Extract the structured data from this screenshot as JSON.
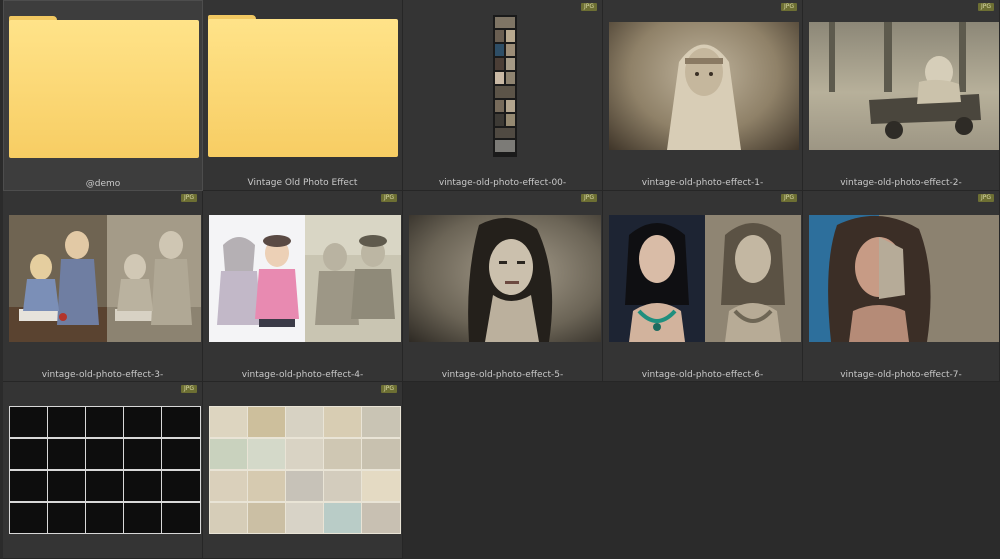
{
  "items": [
    {
      "name": "@demo",
      "type": "folder",
      "badge": ""
    },
    {
      "name": "Vintage Old Photo Effect",
      "type": "folder",
      "badge": ""
    },
    {
      "name": "vintage-old-photo-effect-00-",
      "type": "image",
      "badge": "JPG"
    },
    {
      "name": "vintage-old-photo-effect-1-",
      "type": "image",
      "badge": "JPG"
    },
    {
      "name": "vintage-old-photo-effect-2-",
      "type": "image",
      "badge": "JPG"
    },
    {
      "name": "vintage-old-photo-effect-3-",
      "type": "image",
      "badge": "JPG"
    },
    {
      "name": "vintage-old-photo-effect-4-",
      "type": "image",
      "badge": "JPG"
    },
    {
      "name": "vintage-old-photo-effect-5-",
      "type": "image",
      "badge": "JPG"
    },
    {
      "name": "vintage-old-photo-effect-6-",
      "type": "image",
      "badge": "JPG"
    },
    {
      "name": "vintage-old-photo-effect-7-",
      "type": "image",
      "badge": "JPG"
    },
    {
      "name": "",
      "type": "image",
      "badge": "JPG"
    },
    {
      "name": "",
      "type": "image",
      "badge": "JPG"
    }
  ],
  "colors": {
    "background": "#2b2b2b",
    "cell": "#343434",
    "cell_selected": "#3d3d3d",
    "badge": "#6d6f33",
    "folder": "#f7cd63",
    "sepia": "#9a8d73"
  }
}
